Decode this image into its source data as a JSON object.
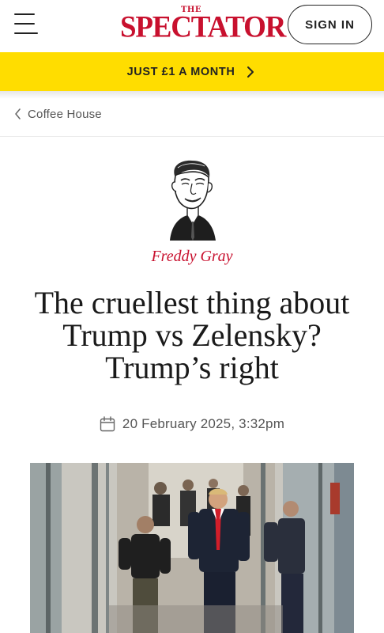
{
  "header": {
    "logo_small": "THE",
    "logo_main": "SPECTATOR",
    "signin_label": "SIGN IN"
  },
  "promo": {
    "label": "JUST £1 A MONTH"
  },
  "breadcrumb": {
    "label": "Coffee House"
  },
  "article": {
    "author": "Freddy Gray",
    "headline": "The cruellest thing about Trump vs Zelensky? Trump’s right",
    "date": "20 February 2025, 3:32pm"
  },
  "colors": {
    "brand_red": "#c8102e",
    "promo_yellow": "#ffdd00"
  },
  "icons": {
    "menu": "hamburger-icon",
    "promo": "chevron-right-icon",
    "breadcrumb": "chevron-left-icon",
    "date": "calendar-icon"
  }
}
